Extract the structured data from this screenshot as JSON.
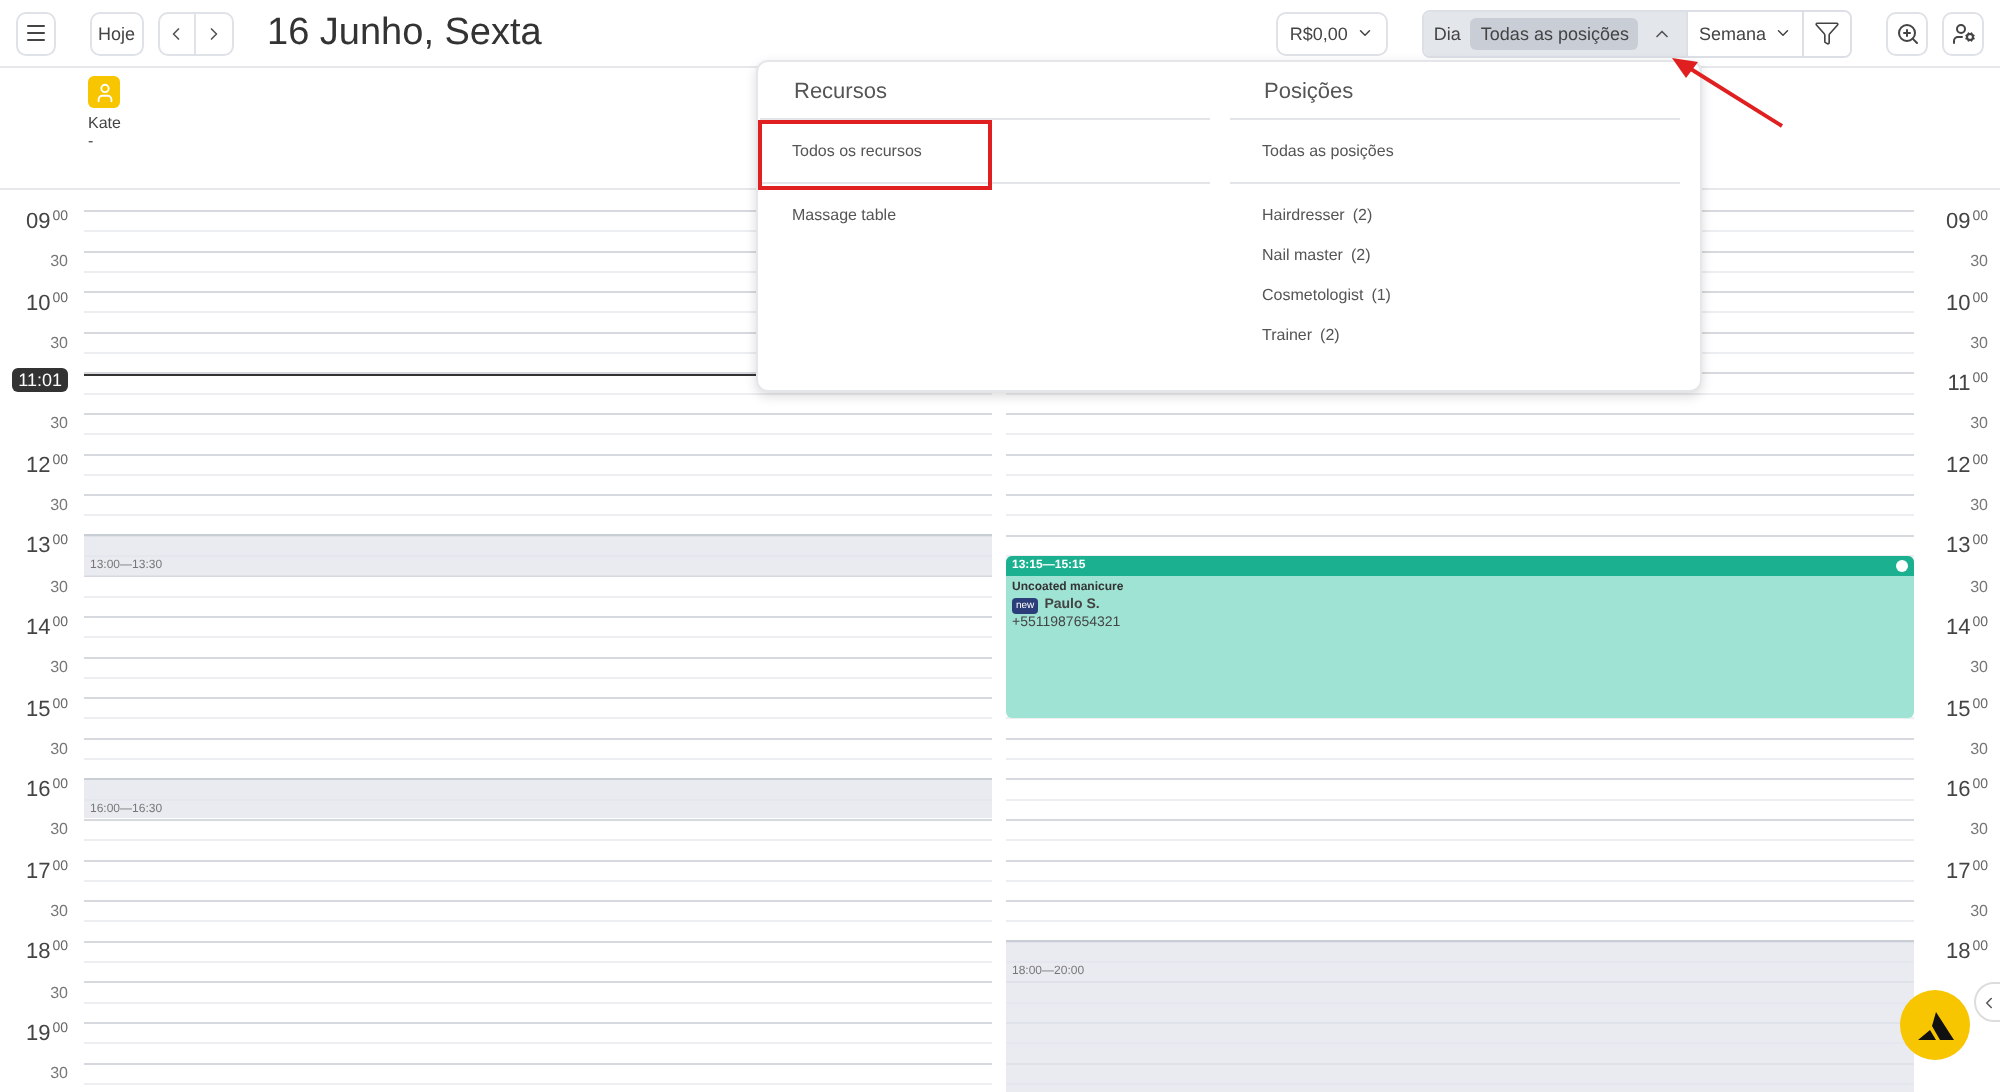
{
  "header": {
    "today_button": "Hoje",
    "title": "16 Junho, Sexta",
    "balance": "R$0,00",
    "day_label": "Dia",
    "position_filter": {
      "value": "Todas as posições",
      "expanded": true
    },
    "range": "Semana"
  },
  "resources": [
    {
      "name": "Kate",
      "subtitle": "-"
    }
  ],
  "left_times": [
    {
      "kind": "hour",
      "hour": "09",
      "minute": "00"
    },
    {
      "kind": "half",
      "minute": "30"
    },
    {
      "kind": "hour",
      "hour": "10",
      "minute": "00"
    },
    {
      "kind": "half",
      "minute": "30"
    },
    {
      "kind": "now",
      "label": "11:01"
    },
    {
      "kind": "half",
      "minute": "30"
    },
    {
      "kind": "hour",
      "hour": "12",
      "minute": "00"
    },
    {
      "kind": "half",
      "minute": "30"
    },
    {
      "kind": "hour",
      "hour": "13",
      "minute": "00"
    },
    {
      "kind": "half",
      "minute": "30"
    },
    {
      "kind": "hour",
      "hour": "14",
      "minute": "00"
    },
    {
      "kind": "half",
      "minute": "30"
    },
    {
      "kind": "hour",
      "hour": "15",
      "minute": "00"
    },
    {
      "kind": "half",
      "minute": "30"
    },
    {
      "kind": "hour",
      "hour": "16",
      "minute": "00"
    },
    {
      "kind": "half",
      "minute": "30"
    },
    {
      "kind": "hour",
      "hour": "17",
      "minute": "00"
    },
    {
      "kind": "half",
      "minute": "30"
    },
    {
      "kind": "hour",
      "hour": "18",
      "minute": "00"
    },
    {
      "kind": "half",
      "minute": "30"
    },
    {
      "kind": "hour",
      "hour": "19",
      "minute": "00"
    },
    {
      "kind": "half",
      "minute": "30"
    }
  ],
  "right_times": [
    {
      "kind": "hour",
      "hour": "09",
      "minute": "00"
    },
    {
      "kind": "half",
      "minute": "30"
    },
    {
      "kind": "hour",
      "hour": "10",
      "minute": "00"
    },
    {
      "kind": "half",
      "minute": "30"
    },
    {
      "kind": "hour",
      "hour": "11",
      "minute": "00"
    },
    {
      "kind": "half",
      "minute": "30"
    },
    {
      "kind": "hour",
      "hour": "12",
      "minute": "00"
    },
    {
      "kind": "half",
      "minute": "30"
    },
    {
      "kind": "hour",
      "hour": "13",
      "minute": "00"
    },
    {
      "kind": "half",
      "minute": "30"
    },
    {
      "kind": "hour",
      "hour": "14",
      "minute": "00"
    },
    {
      "kind": "half",
      "minute": "30"
    },
    {
      "kind": "hour",
      "hour": "15",
      "minute": "00"
    },
    {
      "kind": "half",
      "minute": "30"
    },
    {
      "kind": "hour",
      "hour": "16",
      "minute": "00"
    },
    {
      "kind": "half",
      "minute": "30"
    },
    {
      "kind": "hour",
      "hour": "17",
      "minute": "00"
    },
    {
      "kind": "half",
      "minute": "30"
    },
    {
      "kind": "hour",
      "hour": "18",
      "minute": "00"
    }
  ],
  "columns": [
    {
      "blocks": [
        {
          "kind": "unavailable",
          "start": "13:00",
          "sep": "—",
          "end": "13:30"
        },
        {
          "kind": "unavailable",
          "start": "16:00",
          "sep": "—",
          "end": "16:30"
        }
      ]
    },
    {
      "blocks": [
        {
          "kind": "appointment",
          "start": "13:15",
          "sep": "—",
          "end": "15:15",
          "service": "Uncoated manicure",
          "badge": "new",
          "client": "Paulo S.",
          "phone": "+5511987654321"
        },
        {
          "kind": "unavailable",
          "start": "18:00",
          "sep": "—",
          "end": "20:00"
        }
      ]
    }
  ],
  "dropdown": {
    "sections": [
      {
        "title": "Recursos",
        "items": [
          {
            "kind": "all",
            "label": "Todos os recursos"
          },
          {
            "kind": "item",
            "label": "Massage table"
          }
        ]
      },
      {
        "title": "Posições",
        "items": [
          {
            "kind": "all",
            "label": "Todas as posições"
          },
          {
            "kind": "item",
            "label": "Hairdresser",
            "count": "(2)"
          },
          {
            "kind": "item",
            "label": "Nail master",
            "count": "(2)"
          },
          {
            "kind": "item",
            "label": "Cosmetologist",
            "count": "(1)"
          },
          {
            "kind": "item",
            "label": "Trainer",
            "count": "(2)"
          }
        ]
      }
    ]
  }
}
